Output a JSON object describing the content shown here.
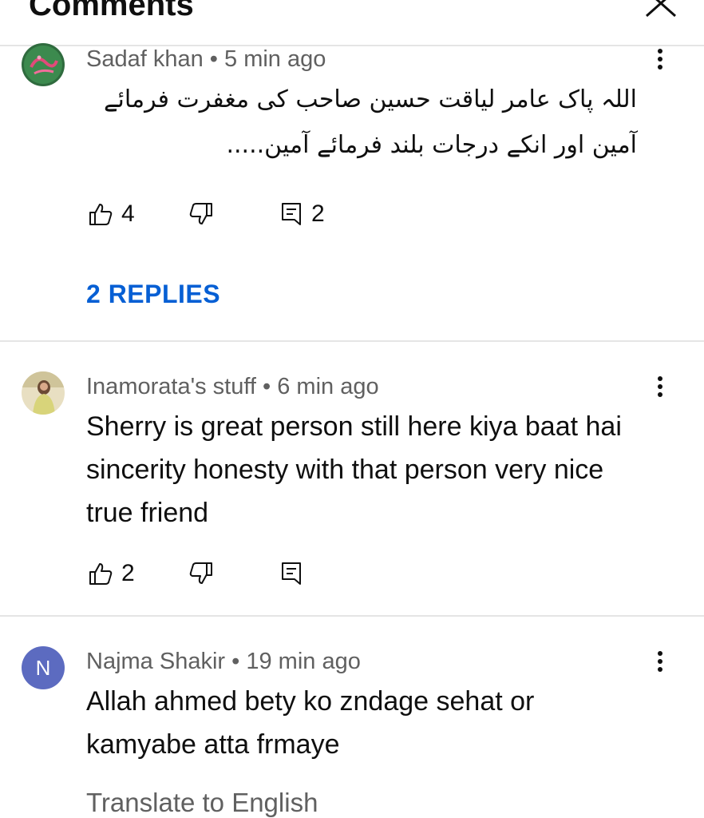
{
  "header": {
    "title": "Comments",
    "close_icon": "close-icon"
  },
  "comments": [
    {
      "author": "Sadaf khan",
      "separator": " • ",
      "time": "5 min ago",
      "text_lines": [
        "اللہ پاک عامر لیاقت حسین صاحب کی مغفرت فرمائے",
        "آمین اور انکے درجات بلند فرمائے آمین....."
      ],
      "likes": "4",
      "reply_count": "2",
      "replies_label": "2 REPLIES",
      "avatar_color": "#3a7a4a"
    },
    {
      "author": "Inamorata's stuff",
      "separator": " • ",
      "time": "6 min ago",
      "text": "Sherry is great person still here kiya baat hai sincerity honesty with that person very nice true friend",
      "likes": "2",
      "reply_count": "",
      "avatar_color": "#d8cfa6"
    },
    {
      "author": "Najma Shakir",
      "separator": " • ",
      "time": "19 min ago",
      "text": "Allah ahmed bety ko zndage sehat or kamyabe atta frmaye",
      "avatar_letter": "N",
      "avatar_color": "#5c6bc0",
      "translate_label": "Translate to English"
    }
  ],
  "colors": {
    "link": "#065fd4",
    "meta": "#606060",
    "divider": "#e5e5e5"
  }
}
